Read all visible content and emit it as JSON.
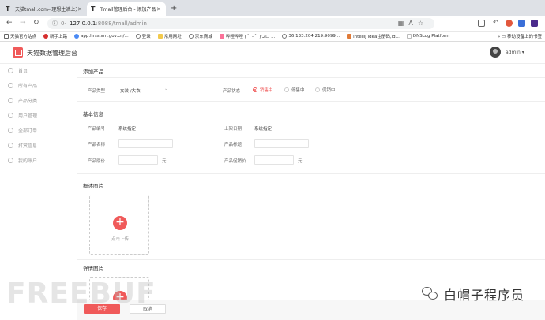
{
  "browser": {
    "tabs": [
      {
        "title": "天猫tmall.com--理想生活上天猫",
        "active": false
      },
      {
        "title": "Tmall管理后台 - 添加产品",
        "active": true
      }
    ],
    "address": {
      "prefix": "0-",
      "host": "127.0.0.1",
      "path": ":8088/tmall/admin"
    },
    "bookmarks": [
      {
        "label": "天猫官方站点",
        "color": "#e4393c"
      },
      {
        "label": "新手上路",
        "color": "#d62f2f"
      },
      {
        "label": "app.hrss.xm.gov.cn/...",
        "color": "#4a8af4"
      },
      {
        "label": "登录",
        "color": "#777777"
      },
      {
        "label": "常用网址",
        "color": "#f2c94c"
      },
      {
        "label": "京东商城",
        "color": "#777777"
      },
      {
        "label": "哔哩哔哩 ( ゜- ゜)つロ ...",
        "color": "#fb7299"
      },
      {
        "label": "36.133.204.219:9099...",
        "color": "#777777"
      },
      {
        "label": "intellij idea注册码,id...",
        "color": "#e07b39"
      },
      {
        "label": "DNSLog Platform",
        "color": "#cccccc"
      }
    ],
    "bookmarks_right": "移动设备上的书签"
  },
  "app": {
    "brand": "天猫数据管理后台",
    "user": "admin ▾"
  },
  "sidebar": {
    "items": [
      {
        "label": "首页"
      },
      {
        "label": "所有产品"
      },
      {
        "label": "产品分类"
      },
      {
        "label": "用户管理"
      },
      {
        "label": "全部订单"
      },
      {
        "label": "打赏信息"
      },
      {
        "label": "我的账户"
      }
    ]
  },
  "page": {
    "title": "添加产品",
    "type_label": "产品类型",
    "type_value": "女装 /大衣",
    "status_label": "产品状态",
    "status_options": [
      "销售中",
      "停售中",
      "促销中"
    ],
    "basic_section": "基本信息",
    "fields": {
      "code_label": "产品编号",
      "code_value": "系统指定",
      "date_label": "上架日期",
      "date_value": "系统指定",
      "name_label": "产品名称",
      "title_label": "产品标题",
      "price_label": "产品原价",
      "sale_label": "产品促销价",
      "unit": "元"
    },
    "overview_section": "概述图片",
    "detail_section": "详情图片",
    "upload_label": "点击上传"
  },
  "footer": {
    "save": "保存",
    "cancel": "取消"
  },
  "watermarks": {
    "left": "FREEBUF",
    "right": "白帽子程序员"
  }
}
